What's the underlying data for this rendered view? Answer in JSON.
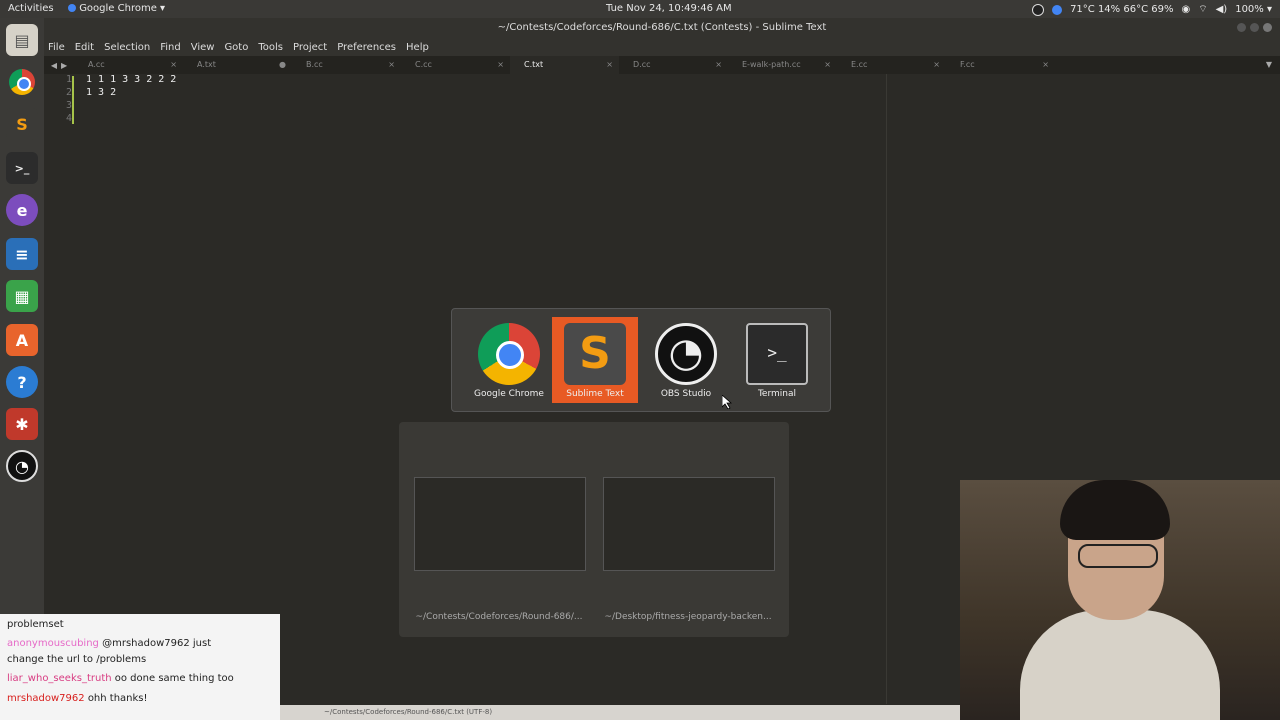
{
  "topbar": {
    "activities": "Activities",
    "app_menu": "Google Chrome ▾",
    "clock": "Tue Nov 24, 10:49:46 AM",
    "temps": "71°C 14% 66°C 69%",
    "battery": "100% ▾"
  },
  "window": {
    "title": "~/Contests/Codeforces/Round-686/C.txt (Contests) - Sublime Text"
  },
  "menu": [
    "File",
    "Edit",
    "Selection",
    "Find",
    "View",
    "Goto",
    "Tools",
    "Project",
    "Preferences",
    "Help"
  ],
  "tabs": [
    {
      "label": "A.cc",
      "close": "×"
    },
    {
      "label": "A.txt",
      "close": "●"
    },
    {
      "label": "B.cc",
      "close": "×"
    },
    {
      "label": "C.cc",
      "close": "×"
    },
    {
      "label": "C.txt",
      "close": "×"
    },
    {
      "label": "D.cc",
      "close": "×"
    },
    {
      "label": "E-walk-path.cc",
      "close": "×"
    },
    {
      "label": "E.cc",
      "close": "×"
    },
    {
      "label": "F.cc",
      "close": "×"
    }
  ],
  "editor": {
    "line_numbers": [
      "1",
      "2",
      "3",
      "4"
    ],
    "lines": [
      "1 1 1 3 3 2 2 2",
      "1 3 2",
      "",
      ""
    ]
  },
  "statusbar": {
    "text": "~/Contests/Codeforces/Round-686/C.txt (UTF-8)"
  },
  "switcher": {
    "apps": [
      {
        "label": "Google Chrome"
      },
      {
        "label": "Sublime Text"
      },
      {
        "label": "OBS Studio"
      },
      {
        "label": "Terminal"
      }
    ]
  },
  "windows_preview": {
    "items": [
      {
        "label": "~/Contests/Codeforces/Round-686/..."
      },
      {
        "label": "~/Desktop/fitness-jeopardy-backen..."
      }
    ]
  },
  "chat": {
    "first": "problemset",
    "messages": [
      {
        "user": "anonymouscubing",
        "text": "@mrshadow7962 just"
      },
      {
        "user": "",
        "text": "change the url to /problems"
      },
      {
        "user": "liar_who_seeks_truth",
        "text": "oo done same thing too"
      },
      {
        "user": "mrshadow7962",
        "text": "ohh thanks!"
      }
    ]
  },
  "colors": {
    "accent": "#e85a24",
    "chrome_blue": "#4285f4"
  }
}
